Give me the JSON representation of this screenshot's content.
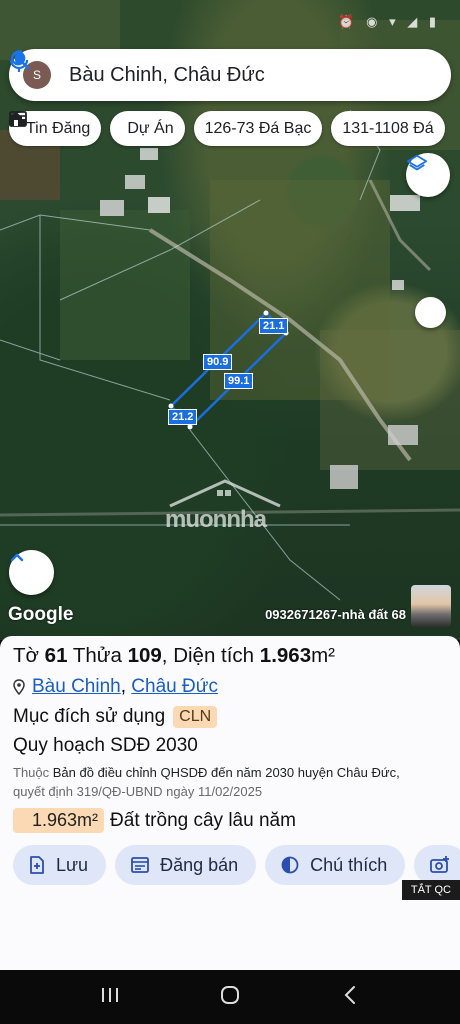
{
  "search": {
    "avatar_letter": "S",
    "query": "Bàu Chinh, Châu Đức"
  },
  "chips": [
    {
      "label": "Tin Đăng",
      "icon": "newspaper-icon"
    },
    {
      "label": "Dự Án",
      "icon": "building-icon"
    },
    {
      "label": "126-73 Đá Bạc",
      "icon": ""
    },
    {
      "label": "131-1108 Đá",
      "icon": ""
    }
  ],
  "map": {
    "measurements": [
      "21.1",
      "90.9",
      "99.1",
      "21.2"
    ],
    "watermark": "muonnha",
    "attribution": "Google",
    "contact": "0932671267-nhà đất 68"
  },
  "parcel": {
    "sheet_label": "Tờ",
    "sheet_no": "61",
    "lot_label": "Thửa",
    "lot_no": "109",
    "area_label": ", Diện tích",
    "area_value": "1.963",
    "area_unit": "m²",
    "commune": "Bàu Chinh",
    "district": "Châu Đức",
    "purpose_label": "Mục đích sử dụng",
    "purpose_code": "CLN",
    "plan_title": "Quy hoạch SDĐ 2030",
    "note_prefix": "Thuộc",
    "note_doc": "Bản đồ điều chỉnh QHSDĐ đến năm 2030 huyện Châu Đức,",
    "note_decision": "quyết định 319/QĐ-UBND ngày 11/02/2025",
    "area_badge": "1.963m²",
    "land_type": "Đất trồng cây lâu năm"
  },
  "actions": [
    {
      "label": "Lưu",
      "icon": "add-document-icon"
    },
    {
      "label": "Đăng bán",
      "icon": "listing-icon"
    },
    {
      "label": "Chú thích",
      "icon": "legend-contrast-icon"
    }
  ],
  "ad_tag": "TẮT QC",
  "colors": {
    "accent_blue": "#1a6fe0",
    "badge_orange": "#fbd9b4",
    "button_bg": "#dfe6f7"
  }
}
